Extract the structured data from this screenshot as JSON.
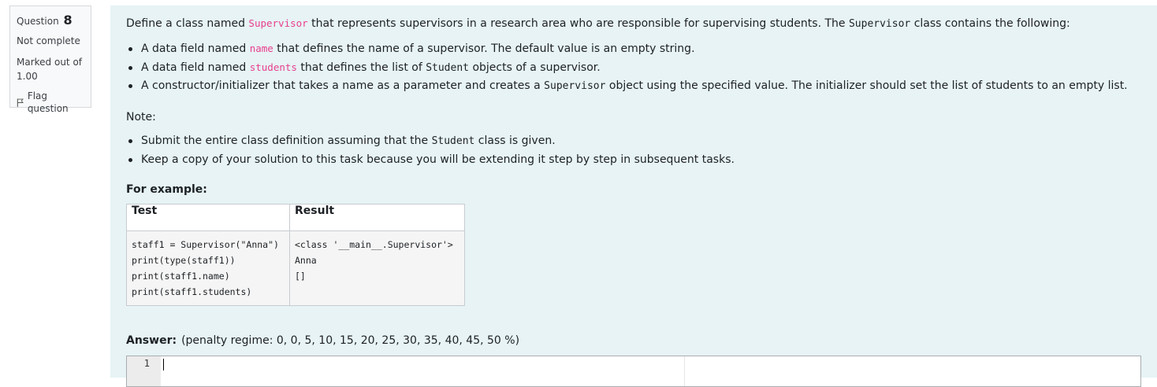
{
  "info": {
    "question_label": "Question",
    "question_number": "8",
    "state": "Not complete",
    "grade_line1": "Marked out of",
    "grade_line2": "1.00",
    "flag_label": "Flag question"
  },
  "question": {
    "intro_pre": "Define a class named ",
    "intro_code": "Supervisor",
    "intro_mid": " that represents supervisors in a research area who are responsible for supervising students. The ",
    "intro_mono": "Supervisor",
    "intro_post": " class contains the following:",
    "bullets": [
      {
        "pre": "A data field named ",
        "code": "name",
        "post": " that defines the name of a supervisor. The default value is an empty string."
      },
      {
        "pre": "A data field named ",
        "code": "students",
        "mid": " that defines the list of ",
        "mono": "Student",
        "post": " objects of a supervisor."
      },
      {
        "pre": "A constructor/initializer that takes a name as a parameter and creates a ",
        "mono": "Supervisor",
        "post": " object using the specified value. The initializer should set the list of students to an empty list."
      }
    ],
    "note_label": "Note:",
    "notes": [
      {
        "pre": "Submit the entire class definition assuming that the ",
        "mono": "Student",
        "post": " class is given."
      },
      {
        "text": "Keep a copy of your solution to this task because you will be extending it step by step in subsequent tasks."
      }
    ],
    "example_label": "For example:",
    "example_table": {
      "headers": [
        "Test",
        "Result"
      ],
      "test_lines": [
        "staff1 = Supervisor(\"Anna\")",
        "print(type(staff1))",
        "print(staff1.name)",
        "print(staff1.students)"
      ],
      "result_lines": [
        "<class '__main__.Supervisor'>",
        "Anna",
        "[]"
      ]
    }
  },
  "answer": {
    "label": "Answer:",
    "penalty": "(penalty regime: 0, 0, 5, 10, 15, 20, 25, 30, 35, 40, 45, 50 %)",
    "editor_line_number": "1",
    "editor_content": ""
  }
}
